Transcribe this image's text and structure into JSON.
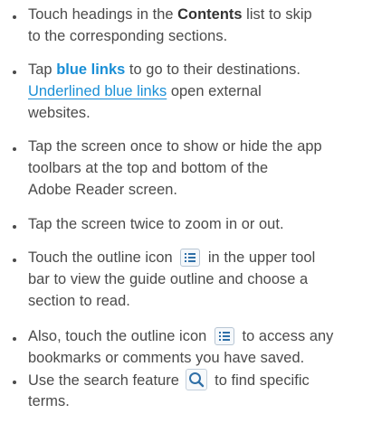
{
  "items": [
    {
      "lines": [
        [
          "Touch headings in the ",
          "Contents",
          " list to skip"
        ],
        [
          "to the corresponding sections."
        ]
      ]
    },
    {
      "lines": [
        [
          "Tap ",
          "blue links",
          " to go to their destinations."
        ],
        [
          "Underlined blue links",
          " open external"
        ],
        [
          "websites."
        ]
      ]
    },
    {
      "lines": [
        [
          "Tap the screen once to show or hide the app"
        ],
        [
          "toolbars at the top and bottom of the"
        ],
        [
          "Adobe Reader screen."
        ]
      ]
    },
    {
      "lines": [
        [
          "Tap the screen twice to zoom in or out."
        ]
      ]
    },
    {
      "lines": [
        [
          "Touch the outline icon ",
          " in the upper tool"
        ],
        [
          "bar to view the guide outline and choose a"
        ],
        [
          "section to read."
        ]
      ]
    },
    {
      "lines": [
        [
          "Also, touch the outline icon ",
          " to access any"
        ],
        [
          "bookmarks or comments you have saved."
        ]
      ]
    },
    {
      "lines": [
        [
          "Use the search feature ",
          " to find specific"
        ],
        [
          "terms."
        ]
      ]
    }
  ],
  "icons": {
    "outline": "outline-list-icon",
    "search": "magnifier-search-icon"
  },
  "colors": {
    "text": "#4a4a4a",
    "link": "#1a8fd6",
    "icon_border": "#b7c5d3",
    "icon_glyph": "#2f6fa7"
  }
}
